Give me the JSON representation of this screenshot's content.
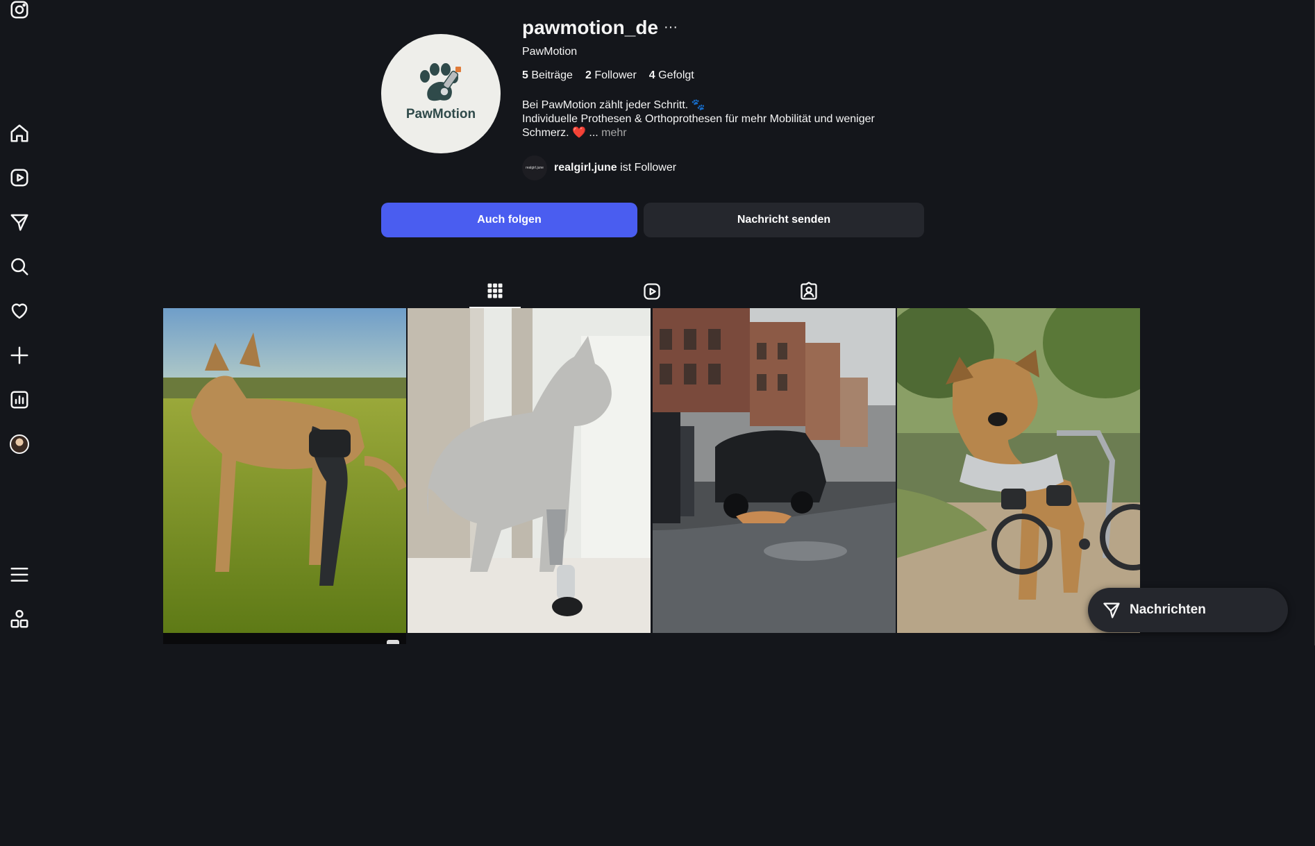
{
  "sidebar": {
    "items": [
      {
        "name": "instagram-logo-icon"
      },
      {
        "name": "home-icon"
      },
      {
        "name": "reels-icon"
      },
      {
        "name": "direct-send-icon"
      },
      {
        "name": "search-icon"
      },
      {
        "name": "notifications-heart-icon"
      },
      {
        "name": "create-plus-icon"
      },
      {
        "name": "insights-chart-icon"
      },
      {
        "name": "profile-avatar"
      },
      {
        "name": "menu-hamburger-icon"
      },
      {
        "name": "more-apps-icon"
      }
    ]
  },
  "profile": {
    "username": "pawmotion_de",
    "more_label": "···",
    "full_name": "PawMotion",
    "avatar_brand": "PawMotion",
    "stats": {
      "posts_count": "5",
      "posts_label": "Beiträge",
      "followers_count": "2",
      "followers_label": "Follower",
      "following_count": "4",
      "following_label": "Gefolgt"
    },
    "bio_line1": "Bei PawMotion zählt jeder Schritt. 🐾",
    "bio_line2": "Individuelle Prothesen & Orthoprothesen für mehr Mobilität und weniger Schmerz. ❤️ ...",
    "bio_more": "mehr",
    "followed_by_avatar_text": "realgirl.june",
    "followed_by_user": "realgirl.june",
    "followed_by_suffix": "ist Follower"
  },
  "actions": {
    "follow_label": "Auch folgen",
    "message_label": "Nachricht senden"
  },
  "tabs": [
    {
      "name": "posts-grid-icon",
      "active": true
    },
    {
      "name": "reels-tab-icon",
      "active": false
    },
    {
      "name": "tagged-tab-icon",
      "active": false
    }
  ],
  "posts": [
    {
      "subject": "dog with leg orthosis in meadow"
    },
    {
      "subject": "cat with prosthetic leg at window"
    },
    {
      "subject": "dog lying on wet street near car"
    },
    {
      "subject": "dog in wheelchair cart"
    }
  ],
  "messages": {
    "label": "Nachrichten"
  },
  "colors": {
    "background": "#14161b",
    "primary_button": "#4a5df0",
    "secondary_button": "#25272d"
  }
}
